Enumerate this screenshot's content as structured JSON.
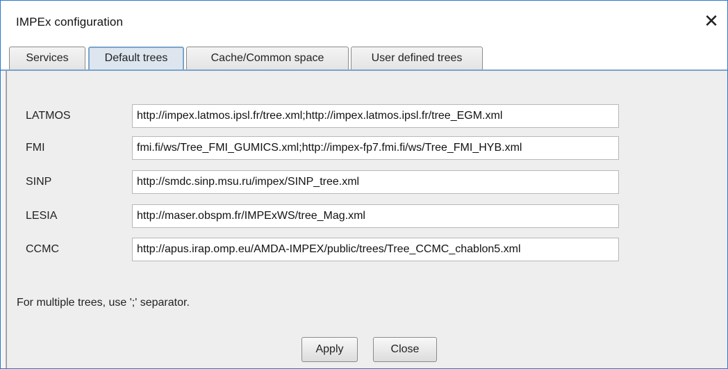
{
  "window": {
    "title": "IMPEx configuration",
    "close_glyph": "✕"
  },
  "tabs": [
    {
      "label": "Services",
      "active": false
    },
    {
      "label": "Default trees",
      "active": true
    },
    {
      "label": "Cache/Common space",
      "active": false
    },
    {
      "label": "User defined trees",
      "active": false
    }
  ],
  "rows": [
    {
      "label": "LATMOS",
      "value": "http://impex.latmos.ipsl.fr/tree.xml;http://impex.latmos.ipsl.fr/tree_EGM.xml"
    },
    {
      "label": "FMI",
      "value": "fmi.fi/ws/Tree_FMI_GUMICS.xml;http://impex-fp7.fmi.fi/ws/Tree_FMI_HYB.xml"
    },
    {
      "label": "SINP",
      "value": "http://smdc.sinp.msu.ru/impex/SINP_tree.xml"
    },
    {
      "label": "LESIA",
      "value": "http://maser.obspm.fr/IMPExWS/tree_Mag.xml"
    },
    {
      "label": "CCMC",
      "value": "http://apus.irap.omp.eu/AMDA-IMPEX/public/trees/Tree_CCMC_chablon5.xml"
    }
  ],
  "hint": "For multiple trees, use ';' separator.",
  "buttons": {
    "apply": "Apply",
    "close": "Close"
  },
  "colors": {
    "window_border": "#2b79c9",
    "active_tab": "#dde6ef",
    "panel_bg": "#eeeeee"
  }
}
